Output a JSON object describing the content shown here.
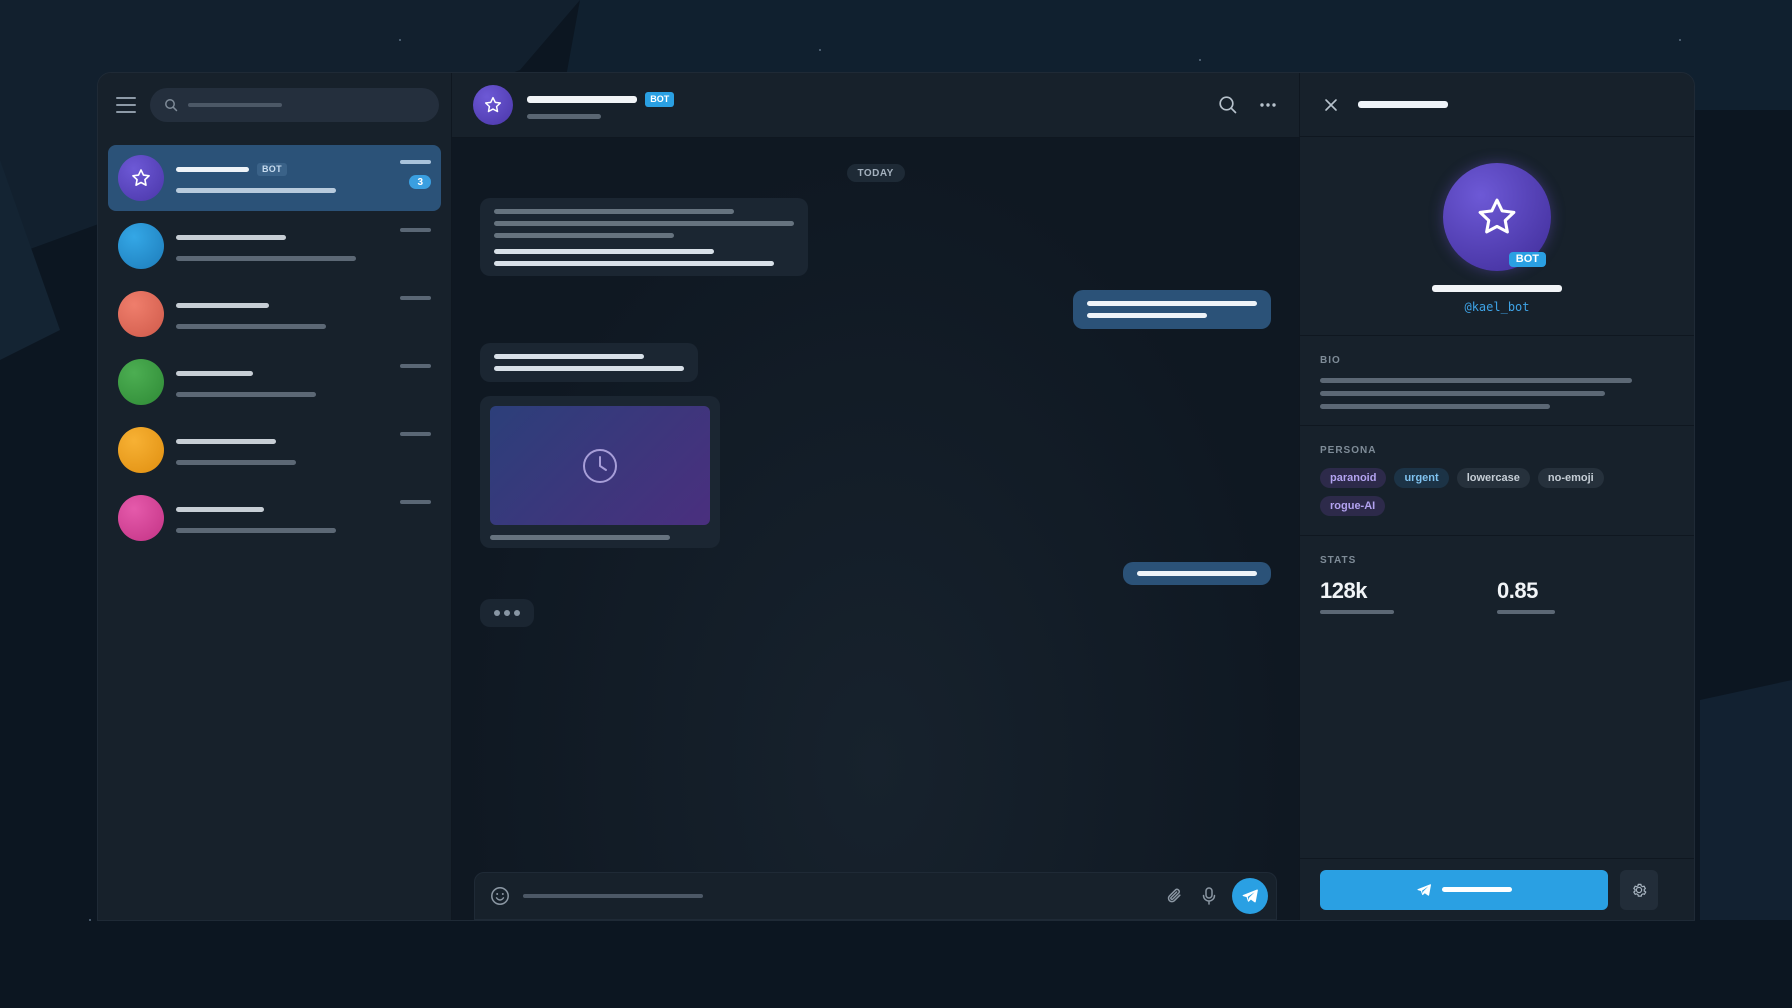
{
  "sidebar": {
    "chats": [
      {
        "avatar_color": "#5e4bc4",
        "bot_badge": "BOT",
        "unread": "3",
        "active": true
      },
      {
        "avatar_color": "#2a93d4"
      },
      {
        "avatar_color": "#e06c5b"
      },
      {
        "avatar_color": "#3f9c45"
      },
      {
        "avatar_color": "#f0a21c"
      },
      {
        "avatar_color": "#d9449a"
      }
    ]
  },
  "chat": {
    "header_badge": "BOT",
    "date_divider": "TODAY"
  },
  "panel": {
    "avatar_badge": "BOT",
    "handle": "@kael_bot",
    "bio_label": "BIO",
    "persona_label": "PERSONA",
    "persona_tags": [
      "paranoid",
      "urgent",
      "lowercase",
      "no-emoji",
      "rogue-AI"
    ],
    "stats_label": "STATS",
    "stats": [
      "128k",
      "0.85"
    ]
  },
  "colors": {
    "accent": "#2aa0e3",
    "outgoing_bubble": "#2b5278",
    "bot_avatar": "#5e4bc4"
  },
  "icons": [
    "menu-icon",
    "search-icon",
    "star-icon",
    "more-icon",
    "close-icon",
    "clock-icon",
    "emoji-icon",
    "paperclip-icon",
    "microphone-icon",
    "send-icon",
    "gear-icon"
  ]
}
